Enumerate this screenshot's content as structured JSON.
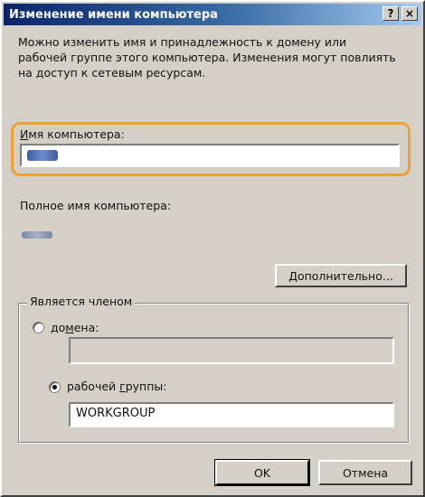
{
  "window": {
    "title": "Изменение имени компьютера",
    "help_button": "?",
    "close_button": "×"
  },
  "description": "Можно изменить имя и принадлежность к домену или рабочей группе этого компьютера. Изменения могут повлиять на доступ к сетевым ресурсам.",
  "computer_name": {
    "label_prefix": "",
    "label_accel": "И",
    "label_rest": "мя компьютера:",
    "value_blurred": true
  },
  "full_name": {
    "label": "Полное имя компьютера:",
    "value_blurred": true
  },
  "more_button": {
    "accel": "Д",
    "rest": "ополнительно..."
  },
  "membership": {
    "group_title": "Является членом",
    "domain": {
      "label_prefix": "до",
      "label_accel": "м",
      "label_rest": "ена:",
      "checked": false,
      "value": ""
    },
    "workgroup": {
      "label_prefix": "рабочей ",
      "label_accel": "г",
      "label_rest": "руппы:",
      "checked": true,
      "value": "WORKGROUP"
    }
  },
  "buttons": {
    "ok": "OK",
    "cancel": "Отмена"
  }
}
